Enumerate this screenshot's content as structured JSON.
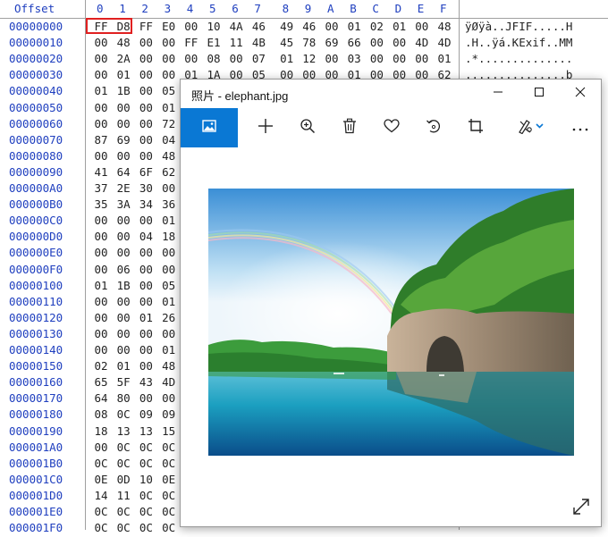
{
  "hex_view": {
    "offset_header": "Offset",
    "column_headers": [
      "0",
      "1",
      "2",
      "3",
      "4",
      "5",
      "6",
      "7",
      "8",
      "9",
      "A",
      "B",
      "C",
      "D",
      "E",
      "F"
    ],
    "rows": [
      {
        "offset": "00000000",
        "bytes": [
          "FF",
          "D8",
          "FF",
          "E0",
          "00",
          "10",
          "4A",
          "46",
          "49",
          "46",
          "00",
          "01",
          "02",
          "01",
          "00",
          "48"
        ],
        "ascii": "ÿØÿà..JFIF.....H"
      },
      {
        "offset": "00000010",
        "bytes": [
          "00",
          "48",
          "00",
          "00",
          "FF",
          "E1",
          "11",
          "4B",
          "45",
          "78",
          "69",
          "66",
          "00",
          "00",
          "4D",
          "4D"
        ],
        "ascii": ".H..ÿá.KExif..MM"
      },
      {
        "offset": "00000020",
        "bytes": [
          "00",
          "2A",
          "00",
          "00",
          "00",
          "08",
          "00",
          "07",
          "01",
          "12",
          "00",
          "03",
          "00",
          "00",
          "00",
          "01"
        ],
        "ascii": ".*.............."
      },
      {
        "offset": "00000030",
        "bytes": [
          "00",
          "01",
          "00",
          "00",
          "01",
          "1A",
          "00",
          "05",
          "00",
          "00",
          "00",
          "01",
          "00",
          "00",
          "00",
          "62"
        ],
        "ascii": "...............b"
      },
      {
        "offset": "00000040",
        "bytes": [
          "01",
          "1B",
          "00",
          "05"
        ],
        "ascii": ""
      },
      {
        "offset": "00000050",
        "bytes": [
          "00",
          "00",
          "00",
          "01"
        ],
        "ascii": ""
      },
      {
        "offset": "00000060",
        "bytes": [
          "00",
          "00",
          "00",
          "72"
        ],
        "ascii": ""
      },
      {
        "offset": "00000070",
        "bytes": [
          "87",
          "69",
          "00",
          "04"
        ],
        "ascii": ""
      },
      {
        "offset": "00000080",
        "bytes": [
          "00",
          "00",
          "00",
          "48"
        ],
        "ascii": ""
      },
      {
        "offset": "00000090",
        "bytes": [
          "41",
          "64",
          "6F",
          "62"
        ],
        "ascii": ""
      },
      {
        "offset": "000000A0",
        "bytes": [
          "37",
          "2E",
          "30",
          "00"
        ],
        "ascii": ""
      },
      {
        "offset": "000000B0",
        "bytes": [
          "35",
          "3A",
          "34",
          "36"
        ],
        "ascii": ""
      },
      {
        "offset": "000000C0",
        "bytes": [
          "00",
          "00",
          "00",
          "01"
        ],
        "ascii": ""
      },
      {
        "offset": "000000D0",
        "bytes": [
          "00",
          "00",
          "04",
          "18"
        ],
        "ascii": ""
      },
      {
        "offset": "000000E0",
        "bytes": [
          "00",
          "00",
          "00",
          "00"
        ],
        "ascii": ""
      },
      {
        "offset": "000000F0",
        "bytes": [
          "00",
          "06",
          "00",
          "00"
        ],
        "ascii": ""
      },
      {
        "offset": "00000100",
        "bytes": [
          "01",
          "1B",
          "00",
          "05"
        ],
        "ascii": ""
      },
      {
        "offset": "00000110",
        "bytes": [
          "00",
          "00",
          "00",
          "01"
        ],
        "ascii": ""
      },
      {
        "offset": "00000120",
        "bytes": [
          "00",
          "00",
          "01",
          "26"
        ],
        "ascii": ""
      },
      {
        "offset": "00000130",
        "bytes": [
          "00",
          "00",
          "00",
          "00"
        ],
        "ascii": ""
      },
      {
        "offset": "00000140",
        "bytes": [
          "00",
          "00",
          "00",
          "01"
        ],
        "ascii": ""
      },
      {
        "offset": "00000150",
        "bytes": [
          "02",
          "01",
          "00",
          "48"
        ],
        "ascii": ""
      },
      {
        "offset": "00000160",
        "bytes": [
          "65",
          "5F",
          "43",
          "4D"
        ],
        "ascii": ""
      },
      {
        "offset": "00000170",
        "bytes": [
          "64",
          "80",
          "00",
          "00"
        ],
        "ascii": ""
      },
      {
        "offset": "00000180",
        "bytes": [
          "08",
          "0C",
          "09",
          "09"
        ],
        "ascii": ""
      },
      {
        "offset": "00000190",
        "bytes": [
          "18",
          "13",
          "13",
          "15"
        ],
        "ascii": ""
      },
      {
        "offset": "000001A0",
        "bytes": [
          "00",
          "0C",
          "0C",
          "0C"
        ],
        "ascii": ""
      },
      {
        "offset": "000001B0",
        "bytes": [
          "0C",
          "0C",
          "0C",
          "0C"
        ],
        "ascii": ""
      },
      {
        "offset": "000001C0",
        "bytes": [
          "0E",
          "0D",
          "10",
          "0E"
        ],
        "ascii": ""
      },
      {
        "offset": "000001D0",
        "bytes": [
          "14",
          "11",
          "0C",
          "0C"
        ],
        "ascii": ""
      },
      {
        "offset": "000001E0",
        "bytes": [
          "0C",
          "0C",
          "0C",
          "0C"
        ],
        "ascii": ""
      },
      {
        "offset": "000001F0",
        "bytes": [
          "0C",
          "0C",
          "0C",
          "0C"
        ],
        "ascii": ""
      }
    ],
    "highlight_color": "#e02020",
    "offset_color": "#1f3fbf"
  },
  "photo_window": {
    "title": "照片 - elephant.jpg",
    "controls": [
      {
        "name": "minimize",
        "icon": "minimize-icon"
      },
      {
        "name": "maximize",
        "icon": "maximize-icon"
      },
      {
        "name": "close",
        "icon": "close-icon"
      }
    ],
    "toolbar": [
      {
        "name": "view-image",
        "icon": "image-icon"
      },
      {
        "name": "add",
        "icon": "plus-icon"
      },
      {
        "name": "zoom",
        "icon": "zoom-in-icon"
      },
      {
        "name": "delete",
        "icon": "trash-icon"
      },
      {
        "name": "favorite",
        "icon": "heart-icon"
      },
      {
        "name": "rotate",
        "icon": "rotate-icon"
      },
      {
        "name": "crop",
        "icon": "crop-icon"
      },
      {
        "name": "edit",
        "icon": "edit-draw-icon"
      },
      {
        "name": "more",
        "icon": "more-icon"
      }
    ],
    "accent": "#0a78d4",
    "expand_icon": "expand-icon"
  }
}
